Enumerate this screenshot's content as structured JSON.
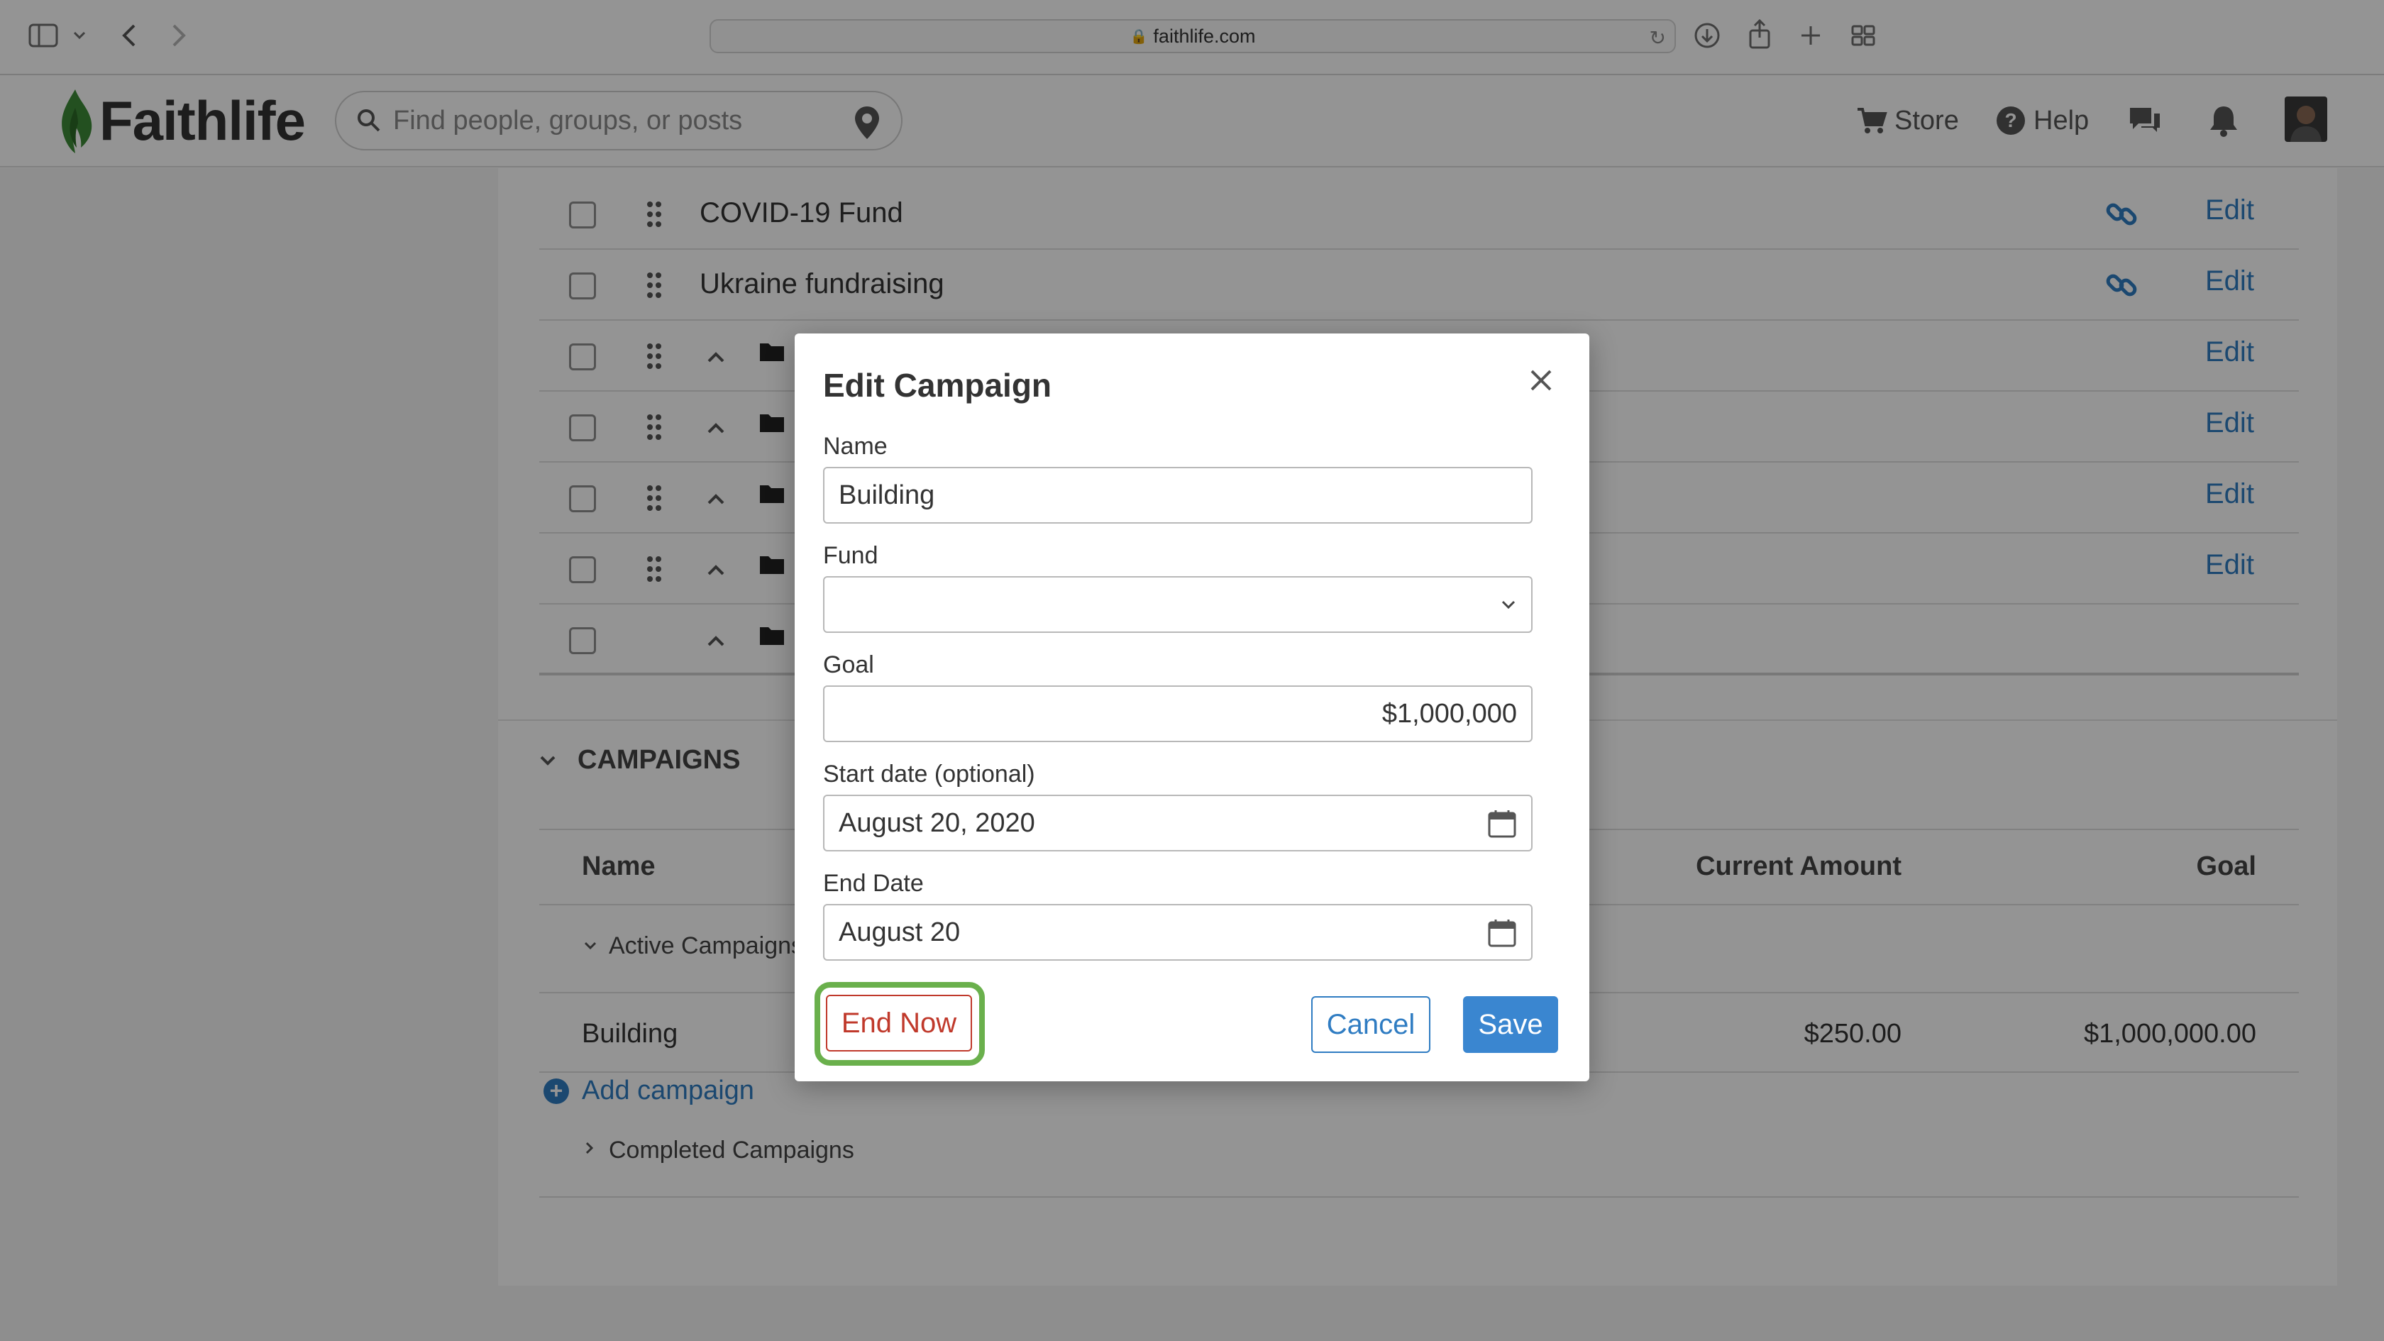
{
  "browser": {
    "url": "faithlife.com"
  },
  "header": {
    "brand": "Faithlife",
    "search_placeholder": "Find people, groups, or posts",
    "store_label": "Store",
    "help_label": "Help"
  },
  "funds": {
    "rows": [
      {
        "name": "COVID-19 Fund",
        "edit": "Edit"
      },
      {
        "name": "Ukraine fundraising",
        "edit": "Edit"
      },
      {
        "edit": "Edit"
      },
      {
        "edit": "Edit"
      },
      {
        "edit": "Edit"
      },
      {
        "edit": "Edit"
      },
      {}
    ]
  },
  "campaigns": {
    "section_title": "CAMPAIGNS",
    "columns": {
      "name": "Name",
      "current_amount": "Current Amount",
      "goal": "Goal"
    },
    "active_group": "Active Campaigns",
    "completed_group": "Completed Campaigns",
    "rows": [
      {
        "name": "Building",
        "current_amount": "$250.00",
        "goal": "$1,000,000.00"
      }
    ],
    "add_label": "Add campaign"
  },
  "modal": {
    "title": "Edit Campaign",
    "name_label": "Name",
    "name_value": "Building",
    "fund_label": "Fund",
    "fund_value": "",
    "goal_label": "Goal",
    "goal_value": "$1,000,000",
    "start_label": "Start date (optional)",
    "start_value": "August 20, 2020",
    "end_label": "End Date",
    "end_value": "August 20",
    "end_now_label": "End Now",
    "cancel_label": "Cancel",
    "save_label": "Save"
  },
  "colors": {
    "link_blue": "#2f7cc2",
    "save_blue": "#3a86d0",
    "danger_red": "#c0392b",
    "highlight_green": "#6ab04c",
    "brand_green": "#3d8b37"
  }
}
